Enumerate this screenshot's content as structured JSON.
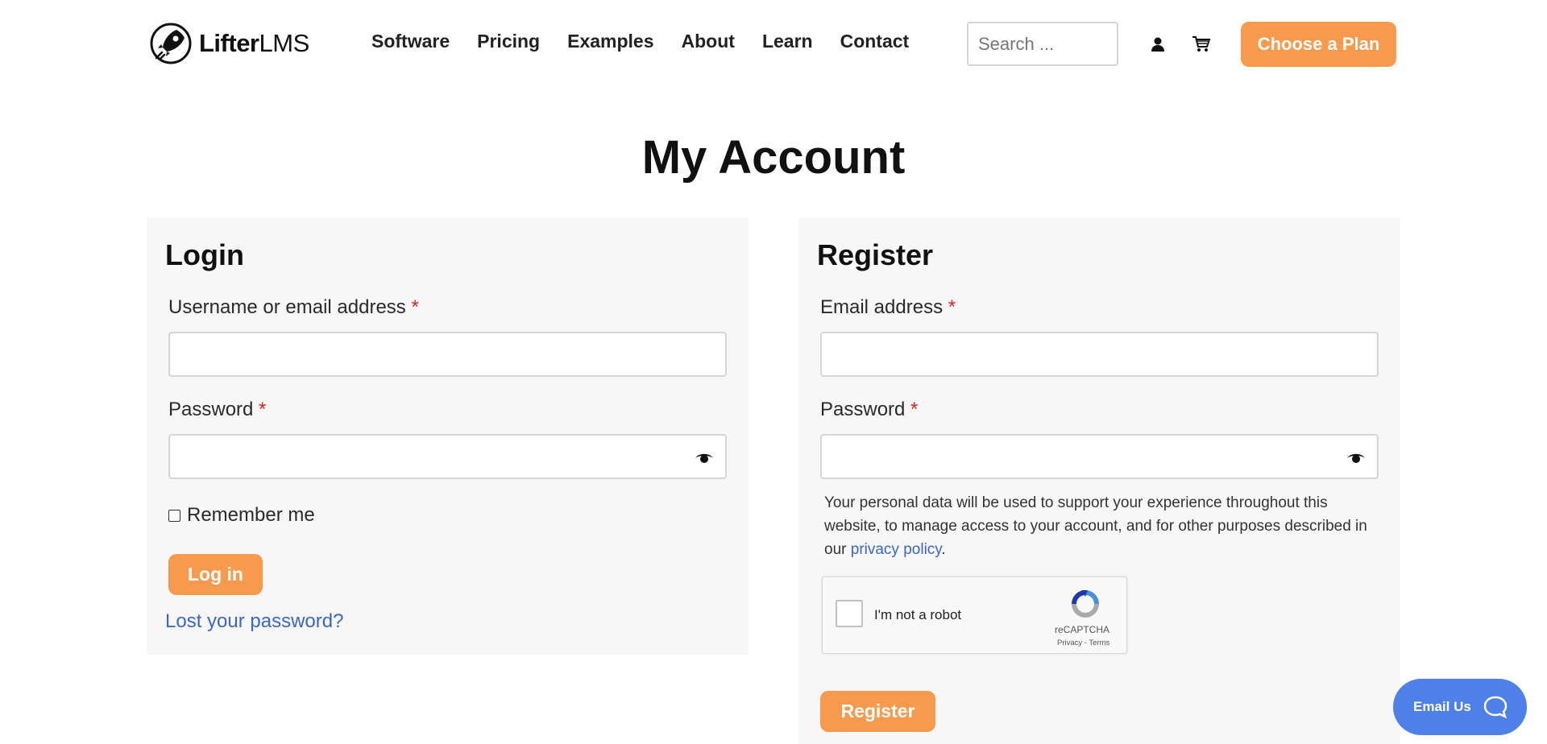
{
  "header": {
    "logo": {
      "brand_bold": "Lifter",
      "brand_light": "LMS",
      "icon": "rocket-icon"
    },
    "nav": [
      "Software",
      "Pricing",
      "Examples",
      "About",
      "Learn",
      "Contact"
    ],
    "search_placeholder": "Search ...",
    "icons": [
      "user-icon",
      "cart-icon"
    ],
    "cta_label": "Choose a Plan"
  },
  "page": {
    "title": "My Account"
  },
  "login": {
    "heading": "Login",
    "username_label": "Username or email address",
    "username_value": "",
    "password_label": "Password",
    "password_value": "",
    "remember_label": "Remember me",
    "remember_checked": false,
    "submit_label": "Log in",
    "lost_password_link": "Lost your password?"
  },
  "register": {
    "heading": "Register",
    "email_label": "Email address",
    "email_value": "",
    "password_label": "Password",
    "password_value": "",
    "privacy_text_before": "Your personal data will be used to support your experience throughout this website, to manage access to your account, and for other purposes described in our ",
    "privacy_link": "privacy policy",
    "privacy_text_after": ".",
    "recaptcha": {
      "label": "I'm not a robot",
      "brand": "reCAPTCHA",
      "links": "Privacy - Terms"
    },
    "submit_label": "Register"
  },
  "required_marker": "*",
  "colors": {
    "accent": "#f79a4e",
    "link": "#3b66c9",
    "chat": "#4f7fe8",
    "panel_bg": "#f7f7f7",
    "required": "#e2231a"
  },
  "chat_widget": {
    "label": "Email Us",
    "icon": "chat-bubble-icon"
  }
}
